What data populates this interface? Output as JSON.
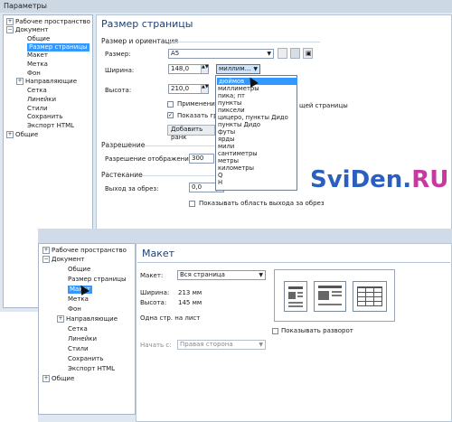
{
  "window1": {
    "title": "Параметры",
    "tree": {
      "workspace": "Рабочее пространство",
      "document": "Документ",
      "general": "Общие",
      "page_size": "Размер страницы",
      "layout": "Макет",
      "label": "Метка",
      "background": "Фон",
      "guides": "Направляющие",
      "grid": "Сетка",
      "rulers": "Линейки",
      "styles": "Стили",
      "save": "Сохранить",
      "export_html": "Экспорт HTML",
      "general2": "Общие"
    },
    "heading": "Размер страницы",
    "size_orientation": "Размер и ориентация",
    "size_label": "Размер:",
    "size_value": "A5",
    "width_label": "Ширина:",
    "width_value": "148,0",
    "height_label": "Высота:",
    "height_value": "210,0",
    "unit_value": "миллим…",
    "apply_label": "Применение",
    "apply_suffix": "щей страницы",
    "show_label": "Показать гр",
    "add_button": "Добавить ранк",
    "resolution_title": "Разрешение",
    "resolution_label": "Разрешение отображения:",
    "resolution_value": "300",
    "bleed_title": "Растекание",
    "bleed_label": "Выход за обрез:",
    "bleed_value": "0,0",
    "bleed_unit": "H",
    "show_bleed": "Показывать область выхода за обрез",
    "unit_options": [
      "дюймов",
      "миллиметры",
      "пика; пт",
      "пункты",
      "пиксели",
      "цицеро, пункты Дидо",
      "пункты Дидо",
      "футы",
      "ярды",
      "мили",
      "сантиметры",
      "метры",
      "километры",
      "Q",
      "H"
    ],
    "unit_selected_index": 0
  },
  "watermark": {
    "part1": "SviDen.",
    "part2": "RU",
    "colors": [
      "#2b5fbf",
      "#c63aa0",
      "#2b5fbf"
    ]
  },
  "window2": {
    "tree": {
      "workspace": "Рабочее пространство",
      "document": "Документ",
      "general": "Общие",
      "page_size": "Размер страницы",
      "layout": "Макет",
      "label": "Метка",
      "background": "Фон",
      "guides": "Направляющие",
      "grid": "Сетка",
      "rulers": "Линейки",
      "styles": "Стили",
      "save": "Сохранить",
      "export_html": "Экспорт HTML",
      "general2": "Общие"
    },
    "heading": "Макет",
    "layout_label": "Макет:",
    "layout_value": "Вся страница",
    "width_label": "Ширина:",
    "width_value": "213 мм",
    "height_label": "Высота:",
    "height_value": "145 мм",
    "pages_per_sheet": "Одна стр. на лист",
    "start_label": "Начать с:",
    "start_value": "Правая сторона",
    "show_spread": "Показывать разворот"
  },
  "colors": {
    "accent": "#3399ff",
    "heading": "#1e3f74",
    "panel_bg": "#dfe7f1"
  }
}
